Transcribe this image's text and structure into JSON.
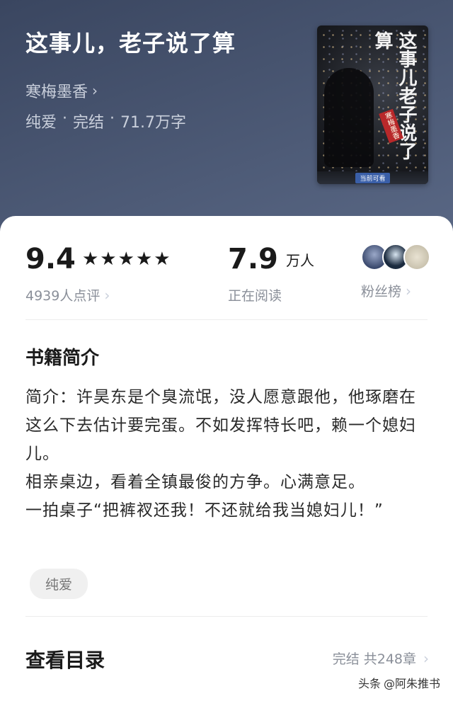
{
  "book": {
    "title": "这事儿，老子说了算",
    "author": "寒梅墨香",
    "meta": [
      "纯爱",
      "·",
      "完结",
      "·",
      "71.7万字"
    ],
    "cover": {
      "title": "这事儿老子说了算",
      "seal": "寒梅墨香",
      "badge": "当前可看"
    }
  },
  "stats": {
    "rating": {
      "value": "9.4",
      "stars": "★★★★★",
      "reviews": "4939人点评"
    },
    "reading": {
      "value": "7.9",
      "unit": "万人",
      "label": "正在阅读"
    },
    "fans": {
      "label": "粉丝榜"
    }
  },
  "intro": {
    "title": "书籍简介",
    "paragraphs": [
      "简介：许昊东是个臭流氓，没人愿意跟他，他琢磨在这么下去估计要完蛋。不如发挥特长吧，赖一个媳妇儿。",
      "相亲桌边，看着全镇最俊的方争。心满意足。",
      "一拍桌子“把裤衩还我！不还就给我当媳妇儿！”"
    ],
    "tag": "纯爱"
  },
  "toc": {
    "title": "查看目录",
    "info": "完结 共248章"
  },
  "watermark": {
    "prefix": "头条",
    "handle": "@阿朱推书"
  },
  "icons": {
    "chevron": "chevron-right-icon",
    "star": "star-icon"
  }
}
